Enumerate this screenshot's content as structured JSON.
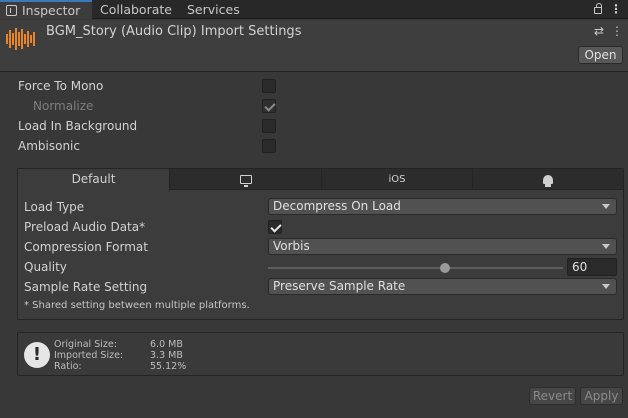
{
  "tabs": {
    "inspector": "Inspector",
    "collaborate": "Collaborate",
    "services": "Services"
  },
  "header": {
    "title": "BGM_Story (Audio Clip) Import Settings",
    "open_label": "Open",
    "asset_icon": "audio-waveform-icon"
  },
  "general": {
    "force_to_mono": {
      "label": "Force To Mono",
      "checked": false
    },
    "normalize": {
      "label": "Normalize",
      "checked": true,
      "disabled": true
    },
    "load_in_background": {
      "label": "Load In Background",
      "checked": false
    },
    "ambisonic": {
      "label": "Ambisonic",
      "checked": false
    }
  },
  "platform": {
    "tabs": {
      "default": "Default",
      "ios": "iOS"
    },
    "load_type": {
      "label": "Load Type",
      "value": "Decompress On Load"
    },
    "preload": {
      "label": "Preload Audio Data*",
      "checked": true
    },
    "compression": {
      "label": "Compression Format",
      "value": "Vorbis"
    },
    "quality": {
      "label": "Quality",
      "value": "60",
      "fraction": 0.6
    },
    "sample_rate": {
      "label": "Sample Rate Setting",
      "value": "Preserve Sample Rate"
    },
    "note": "* Shared setting between multiple platforms."
  },
  "info": {
    "original_label": "Original Size:",
    "original_value": "6.0 MB",
    "imported_label": "Imported Size:",
    "imported_value": "3.3 MB",
    "ratio_label": "Ratio:",
    "ratio_value": "55.12%"
  },
  "footer": {
    "revert": "Revert",
    "apply": "Apply"
  },
  "colors": {
    "accent": "#3a79bb",
    "audio_icon": "#e8842a",
    "background": "#383838"
  }
}
